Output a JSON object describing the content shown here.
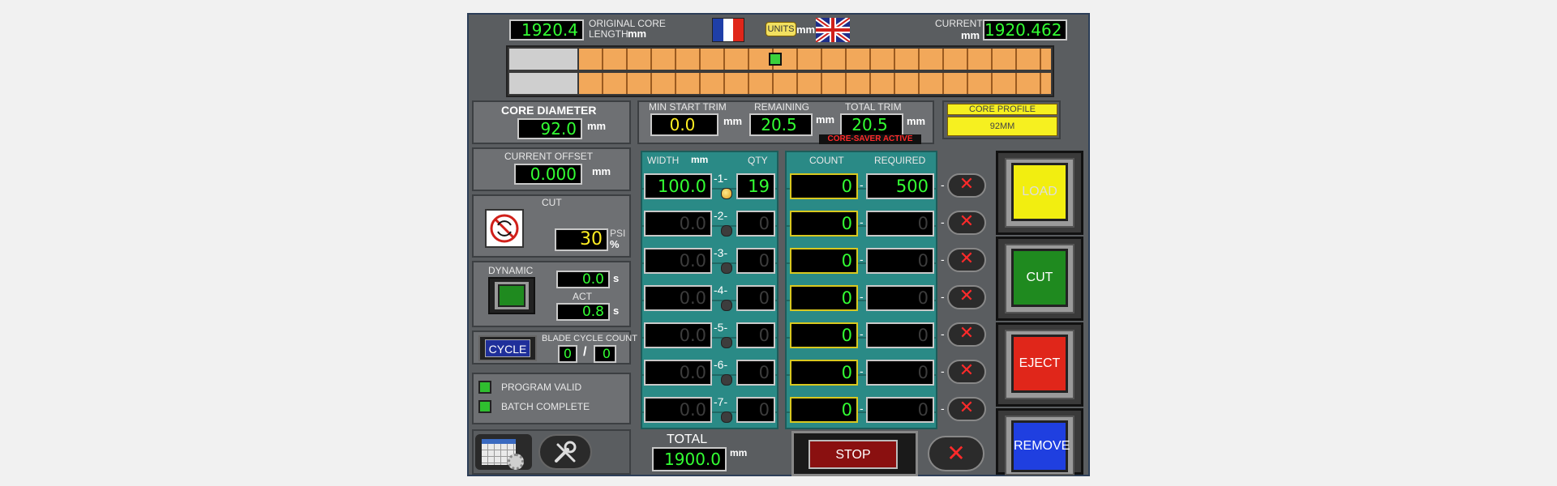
{
  "header": {
    "original_core_value": "1920.4",
    "original_core_label_1": "ORIGINAL CORE",
    "original_core_label_2": "LENGTH",
    "original_core_unit": "mm",
    "units_button": "UNITS",
    "units_value": "mm",
    "current_label": "CURRENT",
    "current_unit": "mm",
    "current_value": "1920.462"
  },
  "core_diameter": {
    "label": "CORE DIAMETER",
    "value": "92.0",
    "unit": "mm"
  },
  "current_offset": {
    "label": "CURRENT OFFSET",
    "value": "0.000",
    "unit": "mm"
  },
  "trim": {
    "min_start_label": "MIN START TRIM",
    "min_start_value": "0.0",
    "min_start_unit": "mm",
    "remaining_label": "REMAINING",
    "remaining_value": "20.5",
    "remaining_unit": "mm",
    "total_label": "TOTAL TRIM",
    "total_value": "20.5",
    "total_unit": "mm",
    "status": "CORE-SAVER ACTIVE"
  },
  "core_profile": {
    "label": "CORE PROFILE",
    "value": "92MM"
  },
  "cut_panel": {
    "label": "CUT",
    "psi_value": "30",
    "psi_unit": "PSI",
    "pct_unit": "%"
  },
  "dynamic_panel": {
    "label": "DYNAMIC",
    "set_value": "0.0",
    "set_unit": "s",
    "act_label": "ACT",
    "act_value": "0.8",
    "act_unit": "s"
  },
  "cycle_panel": {
    "button": "CYCLE",
    "blade_label": "BLADE CYCLE COUNT",
    "count_a": "0",
    "separator": "/",
    "count_b": "0"
  },
  "indicators": {
    "program_valid": "PROGRAM VALID",
    "batch_complete": "BATCH COMPLETE"
  },
  "table": {
    "width_header": "WIDTH",
    "width_unit": "mm",
    "qty_header": "QTY",
    "count_header": "COUNT",
    "required_header": "REQUIRED",
    "rows": [
      {
        "num": "-1-",
        "width": "100.0",
        "qty": "19",
        "count": "0",
        "required": "500",
        "active": true
      },
      {
        "num": "-2-",
        "width": "0.0",
        "qty": "0",
        "count": "0",
        "required": "0",
        "active": false
      },
      {
        "num": "-3-",
        "width": "0.0",
        "qty": "0",
        "count": "0",
        "required": "0",
        "active": false
      },
      {
        "num": "-4-",
        "width": "0.0",
        "qty": "0",
        "count": "0",
        "required": "0",
        "active": false
      },
      {
        "num": "-5-",
        "width": "0.0",
        "qty": "0",
        "count": "0",
        "required": "0",
        "active": false
      },
      {
        "num": "-6-",
        "width": "0.0",
        "qty": "0",
        "count": "0",
        "required": "0",
        "active": false
      },
      {
        "num": "-7-",
        "width": "0.0",
        "qty": "0",
        "count": "0",
        "required": "0",
        "active": false
      }
    ],
    "dash": "-"
  },
  "total": {
    "label": "TOTAL",
    "value": "1900.0",
    "unit": "mm"
  },
  "buttons": {
    "stop": "STOP",
    "load": "LOAD",
    "cut": "CUT",
    "eject": "EJECT",
    "remove": "REMOVE"
  },
  "icons": {
    "x": "✕"
  },
  "colors": {
    "load": "#f2ee10",
    "cut": "#1f8a1f",
    "eject": "#e0261a",
    "remove": "#1f3fe0",
    "stop": "#8a1010",
    "bar_orange": "#f2a85a"
  }
}
